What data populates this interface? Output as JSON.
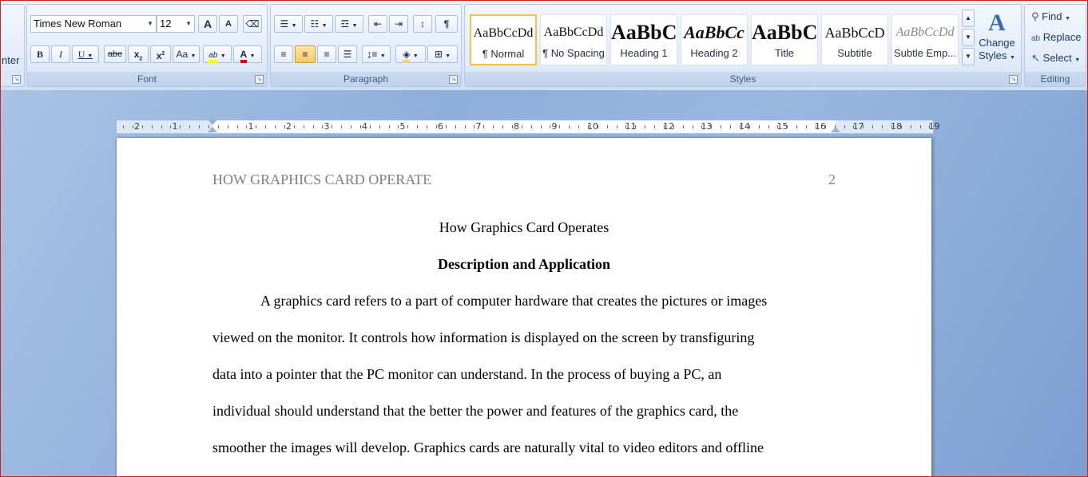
{
  "clipboard": {
    "partial_label": "nter"
  },
  "font": {
    "group_label": "Font",
    "name": "Times New Roman",
    "size": "12",
    "grow_label": "A",
    "shrink_label": "A",
    "bold_label": "B",
    "italic_label": "I",
    "underline_label": "U",
    "strike_label": "abe",
    "subscript_label": "x",
    "superscript_label": "x",
    "case_label": "Aa",
    "highlight_label": "ab",
    "color_label": "A"
  },
  "paragraph": {
    "group_label": "Paragraph",
    "pilcrow": "¶"
  },
  "styles": {
    "group_label": "Styles",
    "tiles": [
      {
        "preview": "AaBbCcDd",
        "name": "¶ Normal"
      },
      {
        "preview": "AaBbCcDd",
        "name": "¶ No Spacing"
      },
      {
        "preview": "AaBbC",
        "name": "Heading 1"
      },
      {
        "preview": "AaBbCc",
        "name": "Heading 2"
      },
      {
        "preview": "AaBbC",
        "name": "Title"
      },
      {
        "preview": "AaBbCcD",
        "name": "Subtitle"
      },
      {
        "preview": "AaBbCcDd",
        "name": "Subtle Emp..."
      }
    ],
    "change_styles_line1": "Change",
    "change_styles_line2": "Styles"
  },
  "editing": {
    "group_label": "Editing",
    "find": "Find",
    "replace": "Replace",
    "select": "Select"
  },
  "ruler": {
    "labels": [
      "2",
      "1",
      "1",
      "2",
      "3",
      "4",
      "5",
      "6",
      "7",
      "8",
      "9",
      "10",
      "11",
      "12",
      "13",
      "14",
      "15",
      "16",
      "17",
      "18",
      "19"
    ]
  },
  "document": {
    "header_left": "HOW GRAPHICS CARD OPERATE",
    "page_number": "2",
    "title": "How Graphics Card Operates",
    "subtitle": "Description and Application",
    "lines": [
      "A graphics card refers to a part of computer hardware that creates the pictures or images",
      "viewed on the monitor. It controls how information is displayed on the screen by transfiguring",
      "data into a pointer that the PC monitor can understand. In the process of buying a PC, an",
      "individual should understand that the better the power and features of the graphics card, the",
      "smoother the images will develop. Graphics cards are naturally vital to video editors and offline"
    ]
  }
}
